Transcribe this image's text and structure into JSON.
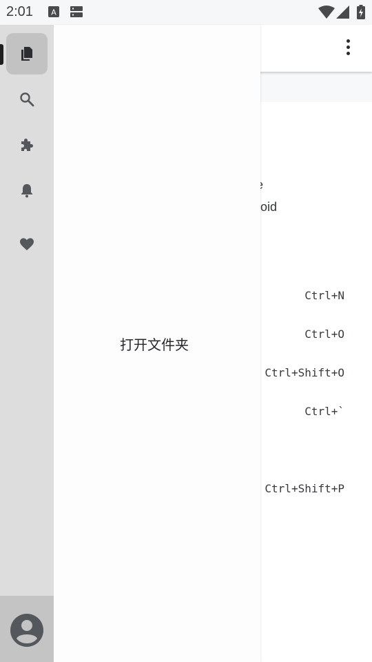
{
  "status_bar": {
    "time": "2:01",
    "icons": [
      "keyboard-a-icon",
      "storage-icon",
      "wifi-icon",
      "signal-icon",
      "battery-charging-icon"
    ]
  },
  "activity_bar": {
    "items": [
      {
        "name": "explorer",
        "icon": "files-icon",
        "active": true
      },
      {
        "name": "search",
        "icon": "search-icon",
        "active": false
      },
      {
        "name": "extensions",
        "icon": "puzzle-icon",
        "active": false
      },
      {
        "name": "notifications",
        "icon": "bell-icon",
        "active": false
      },
      {
        "name": "favorites",
        "icon": "heart-icon",
        "active": false
      }
    ],
    "account_icon": "account-icon"
  },
  "drawer": {
    "open_folder_label": "打开文件夹"
  },
  "background": {
    "toolbar_menu_icon": "more-vert-icon",
    "welcome_lines": [
      "e",
      "roid"
    ],
    "shortcuts": [
      "Ctrl+N",
      "Ctrl+O",
      "Ctrl+Shift+O",
      "Ctrl+`",
      "Ctrl+Shift+P"
    ]
  },
  "colors": {
    "activity_bar_bg": "#dddddd",
    "activity_active_bg": "#c2c2c2",
    "icon_color": "#54575c",
    "drawer_bg": "#fdfdfe"
  }
}
